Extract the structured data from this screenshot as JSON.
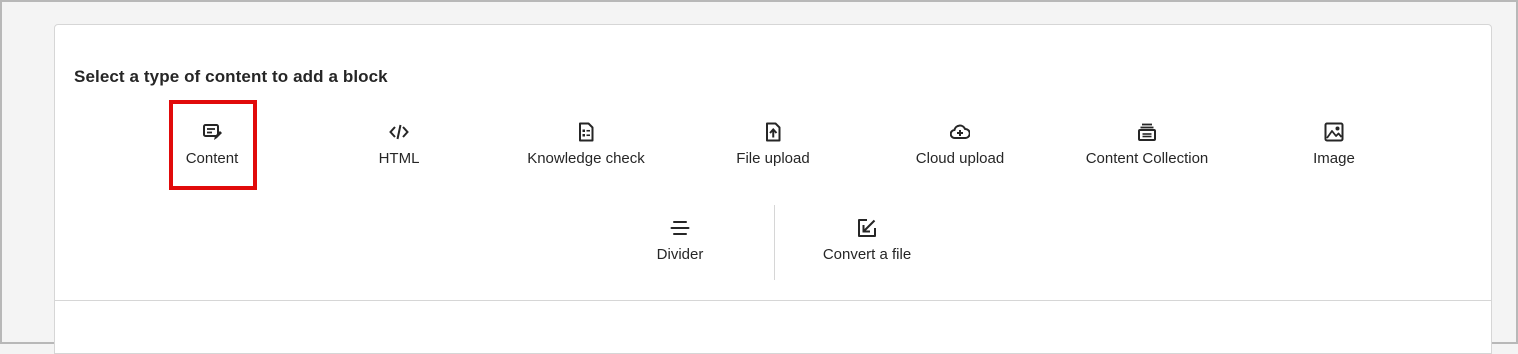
{
  "heading": "Select a type of content to add a block",
  "options": [
    {
      "label": "Content",
      "icon": "content-edit-icon"
    },
    {
      "label": "HTML",
      "icon": "code-icon"
    },
    {
      "label": "Knowledge check",
      "icon": "checklist-icon"
    },
    {
      "label": "File upload",
      "icon": "file-upload-icon"
    },
    {
      "label": "Cloud upload",
      "icon": "cloud-upload-icon"
    },
    {
      "label": "Content Collection",
      "icon": "content-collection-icon"
    },
    {
      "label": "Image",
      "icon": "image-icon"
    },
    {
      "label": "Divider",
      "icon": "divider-icon"
    },
    {
      "label": "Convert a file",
      "icon": "convert-file-icon"
    }
  ],
  "colors": {
    "highlight": "#e10a0a",
    "text": "#262626",
    "border": "#d6d6d6"
  }
}
